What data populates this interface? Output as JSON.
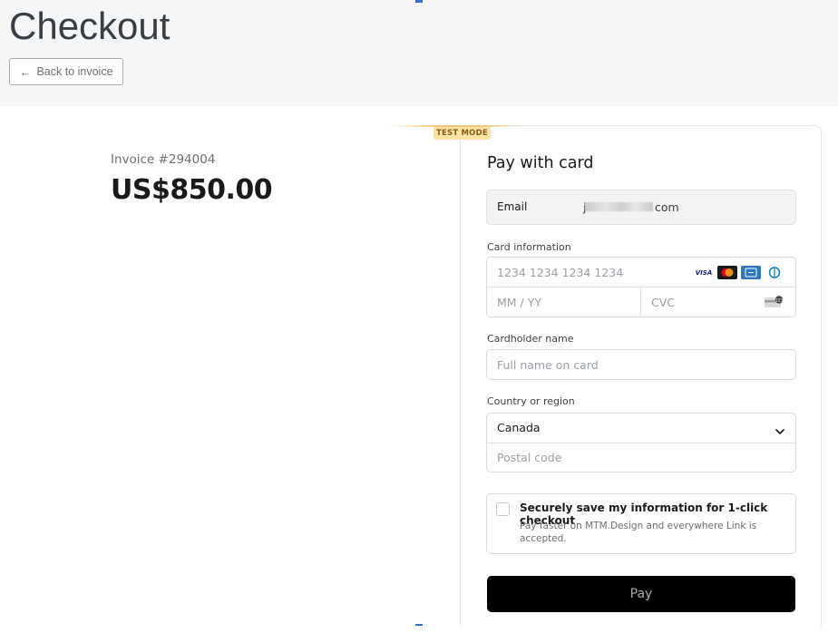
{
  "header": {
    "title": "Checkout",
    "back_label": "Back to invoice",
    "back_arrow": "←"
  },
  "invoice": {
    "number_label": "Invoice #294004",
    "amount": "US$850.00"
  },
  "badge": {
    "test_mode": "TEST MODE"
  },
  "payment": {
    "title": "Pay with card",
    "email_label": "Email",
    "email_value_prefix": "j",
    "email_value_suffix": "com",
    "card_info_label": "Card information",
    "card_number_placeholder": "1234 1234 1234 1234",
    "expiry_placeholder": "MM / YY",
    "cvc_placeholder": "CVC",
    "card_brands": [
      "VISA",
      "mastercard-icon",
      "amex-icon",
      "diners-icon"
    ],
    "cardholder_label": "Cardholder name",
    "cardholder_placeholder": "Full name on card",
    "country_label": "Country or region",
    "country_value": "Canada",
    "postal_placeholder": "Postal code",
    "save_title": "Securely save my information for 1-click checkout",
    "save_desc": "Pay faster on MTM.Design and everywhere Link is accepted.",
    "save_checked": false,
    "pay_label": "Pay"
  },
  "colors": {
    "header_bg": "#f5f6f8",
    "accent_marker": "#3b6fd6",
    "test_badge_bg": "#fde2a7",
    "pay_button_bg": "#000000"
  }
}
